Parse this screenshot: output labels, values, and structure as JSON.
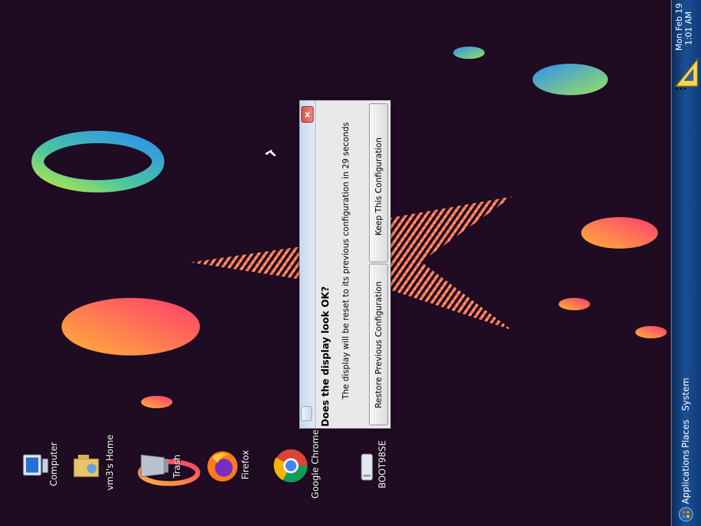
{
  "panel": {
    "menu_applications": "Applications",
    "menu_places": "Places",
    "menu_system": "System",
    "clock_date": "Mon Feb 19",
    "clock_time": "1:01 AM"
  },
  "desktop_icons": [
    {
      "label": "Computer",
      "icon": "computer-icon"
    },
    {
      "label": "vm3's Home",
      "icon": "home-folder-icon"
    },
    {
      "label": "Trash",
      "icon": "trash-icon"
    },
    {
      "label": "Firefox",
      "icon": "firefox-icon"
    },
    {
      "label": "Google Chrome",
      "icon": "chrome-icon"
    },
    {
      "label": "BOOT98SE",
      "icon": "drive-icon"
    }
  ],
  "dialog": {
    "heading": "Does the display look OK?",
    "message": "The display will be reset to its previous configuration in 29 seconds",
    "restore_button": "Restore Previous Configuration",
    "keep_button": "Keep This Configuration",
    "close_glyph": "x"
  },
  "colors": {
    "panel": "#1a4f94",
    "desktop_bg": "#1f0b22",
    "dialog_bg": "#e9e9e9"
  }
}
